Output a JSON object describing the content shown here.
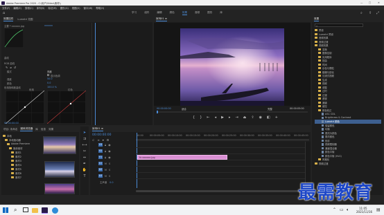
{
  "titlebar": {
    "app_title": "Adobe Premiere Pro 2020 - C:\\用户\\Video\\素材\\\\",
    "window_buttons": [
      "—",
      "□",
      "✕"
    ]
  },
  "menubar": {
    "items": [
      "文件(F)",
      "编辑(E)",
      "剪辑(C)",
      "序列(S)",
      "标记(M)",
      "图形(G)",
      "视图(V)",
      "窗口(W)",
      "帮助(H)"
    ]
  },
  "workspaces": {
    "items": [
      "学习",
      "组件",
      "编辑",
      "颜色",
      "效果",
      "音频",
      "图形",
      "库"
    ],
    "active_index": 4
  },
  "effect_controls": {
    "tabs": [
      "效果控件",
      "Lumetri 范围"
    ],
    "active_tab": 0,
    "clip_name": "主要 * xxxxxx.jpg",
    "sequence_name": "xxxxxx",
    "sections": [
      "曲线",
      "RGB 曲线",
      "色相饱和度曲线"
    ],
    "rows": [
      {
        "label": "模式",
        "value": "亮度"
      },
      {
        "label": "显示色调",
        "value": ""
      },
      {
        "label": "强度",
        "value": "50.0"
      },
      {
        "label": "颜色",
        "value": "0.0"
      },
      {
        "label": "色相与饱和度",
        "value": "100.0 %"
      }
    ],
    "curve_labels": [
      "色相",
      "红色"
    ],
    "timecode": "00:00:00:00"
  },
  "program_monitor": {
    "title": "序列01 ≡",
    "timecode_left": "00:00:00:00",
    "fit_label": "适合",
    "quality_label": "完整",
    "timecode_right": "00:00:05:00"
  },
  "effects_panel": {
    "title": "效果",
    "search_placeholder": "",
    "items": [
      {
        "label": "预设",
        "type": "folder"
      },
      {
        "label": "Lumetri 预设",
        "type": "folder"
      },
      {
        "label": "音频效果",
        "type": "folder"
      },
      {
        "label": "音频过渡",
        "type": "folder"
      },
      {
        "label": "视频效果",
        "type": "folder"
      },
      {
        "label": "变换",
        "type": "folder"
      },
      {
        "label": "图像控制",
        "type": "folder"
      },
      {
        "label": "实用程序",
        "type": "folder"
      },
      {
        "label": "扭曲",
        "type": "folder"
      },
      {
        "label": "时间",
        "type": "folder"
      },
      {
        "label": "杂色与颗粒",
        "type": "folder"
      },
      {
        "label": "模糊与锐化",
        "type": "folder"
      },
      {
        "label": "沉浸式视频",
        "type": "folder"
      },
      {
        "label": "生成",
        "type": "folder"
      },
      {
        "label": "视频",
        "type": "folder"
      },
      {
        "label": "调整",
        "type": "folder"
      },
      {
        "label": "过时",
        "type": "folder"
      },
      {
        "label": "过渡",
        "type": "folder"
      },
      {
        "label": "透视",
        "type": "folder"
      },
      {
        "label": "通道",
        "type": "folder"
      },
      {
        "label": "键控",
        "type": "folder"
      },
      {
        "label": "颜色校正",
        "type": "folder"
      },
      {
        "label": "ASC CDL",
        "type": "file"
      },
      {
        "label": "Brightness & Contrast",
        "type": "file"
      },
      {
        "label": "Lumetri 颜色",
        "type": "file"
      },
      {
        "label": "保留颜色",
        "type": "file"
      },
      {
        "label": "均衡",
        "type": "file"
      },
      {
        "label": "更改为颜色",
        "type": "file"
      },
      {
        "label": "更改颜色",
        "type": "file"
      },
      {
        "label": "色彩",
        "type": "file"
      },
      {
        "label": "视频限制器",
        "type": "file"
      },
      {
        "label": "通道混合器",
        "type": "file"
      },
      {
        "label": "颜色平衡",
        "type": "file"
      },
      {
        "label": "颜色平衡 (HLS)",
        "type": "file"
      },
      {
        "label": "风格化",
        "type": "folder"
      },
      {
        "label": "视频过渡",
        "type": "folder"
      }
    ],
    "highlight_index": 24
  },
  "project_panel": {
    "tabs": [
      "项目: 未命名",
      "媒体浏览器",
      "库",
      "信息",
      "效果",
      "标记"
    ],
    "active_tab": 1,
    "tree": [
      "本地",
      "本地驱动器",
      "Adobe Premiere",
      "媒体素材",
      "素材1",
      "素材2",
      "素材3",
      "素材4",
      "素材5",
      "素材6",
      "素材7"
    ]
  },
  "timeline": {
    "title": "序列01 ≡",
    "timecode": "00:00:00:00",
    "ruler": [
      "00:00",
      "00:00:05:00",
      "00:00:10:00",
      "00:00:15:00",
      "00:00:20:00",
      "00:00:25:00",
      "00:00:30:00",
      "00:00:35:00",
      "00:00:40:00",
      "00:00:45:00"
    ],
    "tracks": [
      "V3",
      "V2",
      "V1",
      "A1",
      "A2",
      "A3"
    ],
    "master_label": "主声道",
    "master_value": "0.0",
    "clip_label": "fx  xxxxxx.jpg"
  },
  "watermark": {
    "text": "最需教育"
  },
  "taskbar": {
    "time": "11:05",
    "date": "2021/11/16"
  },
  "colors": {
    "accent": "#4b8bd6",
    "clip": "#d98fd2",
    "playhead": "#4b8bd6",
    "watermark": "#1d47c8"
  }
}
